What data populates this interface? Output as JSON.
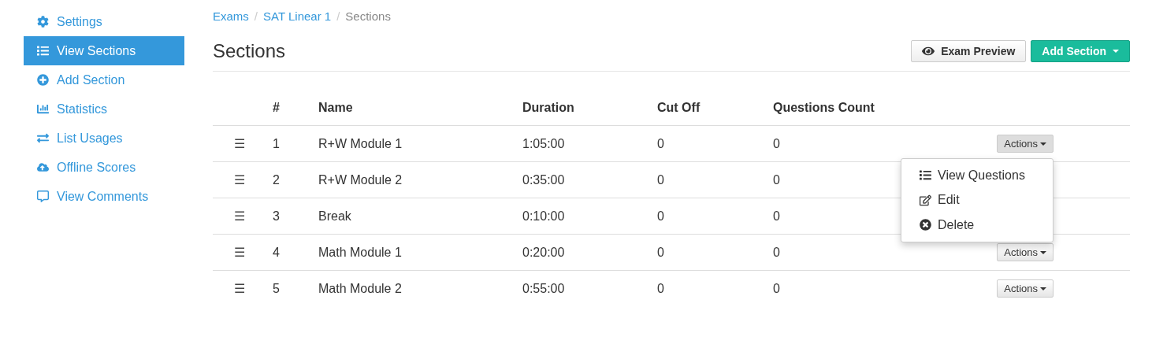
{
  "sidebar": {
    "items": [
      {
        "label": "Settings",
        "selected": false
      },
      {
        "label": "View Sections",
        "selected": true
      },
      {
        "label": "Add Section",
        "selected": false
      },
      {
        "label": "Statistics",
        "selected": false
      },
      {
        "label": "List Usages",
        "selected": false
      },
      {
        "label": "Offline Scores",
        "selected": false
      },
      {
        "label": "View Comments",
        "selected": false
      }
    ]
  },
  "breadcrumb": [
    "Exams",
    "SAT Linear 1",
    "Sections"
  ],
  "breadcrumb_separator": "/",
  "title": "Sections",
  "buttons": [
    {
      "kind": "default",
      "label": "Exam Preview"
    },
    {
      "kind": "primary",
      "label": "Add Section"
    }
  ],
  "table": {
    "columns": [
      "#",
      "Name",
      "Duration",
      "Cut Off",
      "Questions Count"
    ],
    "rows": [
      {
        "handle": "☰",
        "cells": [
          "1",
          "R+W Module 1",
          "1:05:00",
          "0",
          "0"
        ],
        "actions": "Actions",
        "expanded": true
      },
      {
        "handle": "☰",
        "cells": [
          "2",
          "R+W Module 2",
          "0:35:00",
          "0",
          "0"
        ]
      },
      {
        "handle": "☰",
        "cells": [
          "3",
          "Break",
          "0:10:00",
          "0",
          "0"
        ]
      },
      {
        "handle": "☰",
        "cells": [
          "4",
          "Math Module 1",
          "0:20:00",
          "0",
          "0"
        ],
        "actions": "Actions",
        "expanded": false
      },
      {
        "handle": "☰",
        "cells": [
          "5",
          "Math Module 2",
          "0:55:00",
          "0",
          "0"
        ],
        "actions": "Actions",
        "expanded": false
      }
    ]
  },
  "dropdown_menu": [
    "View Questions",
    "Edit",
    "Delete"
  ]
}
